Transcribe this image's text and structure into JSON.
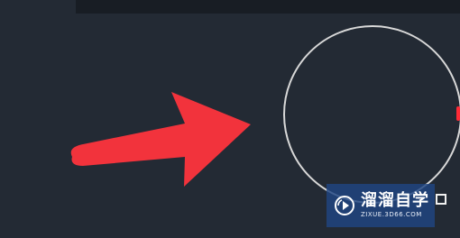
{
  "watermark": {
    "title": "溜溜自学",
    "url": "ZIXUE.3D66.COM"
  },
  "colors": {
    "background": "#232a34",
    "top_bar": "#181d24",
    "arrow": "#f2333c",
    "circle_stroke": "#d8d8d8",
    "watermark_bg": "#204682",
    "accent_marker": "#ff2a36"
  },
  "icons": {
    "arrow": "red-arrow-icon",
    "circle": "circle-outline",
    "grip": "grip-handle-icon",
    "logo": "play-logo-icon"
  }
}
